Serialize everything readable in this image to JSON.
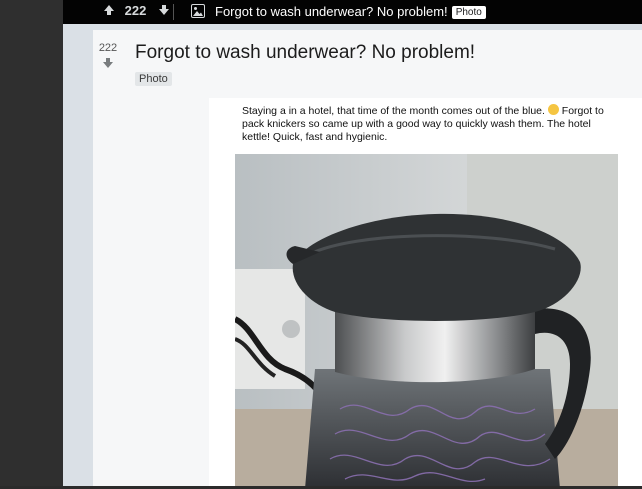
{
  "topbar": {
    "score": "222",
    "title": "Forgot to wash underwear? No problem!",
    "flair": "Photo"
  },
  "post": {
    "score": "222",
    "title": "Forgot to wash underwear? No problem!",
    "flair": "Photo",
    "caption": "Staying a in a hotel, that time of the month comes out of the blue.",
    "caption_rest": "Forgot to pack knickers so came up with a good way to quickly wash them. The hotel kettle!  Quick, fast and hygienic."
  },
  "icons": [
    "upvote-icon",
    "downvote-icon",
    "image-icon",
    "emoji-icon"
  ],
  "colors": {
    "topbar_bg": "#030303",
    "page_bg": "#dae0e6",
    "post_bg": "#f6f7f8"
  }
}
